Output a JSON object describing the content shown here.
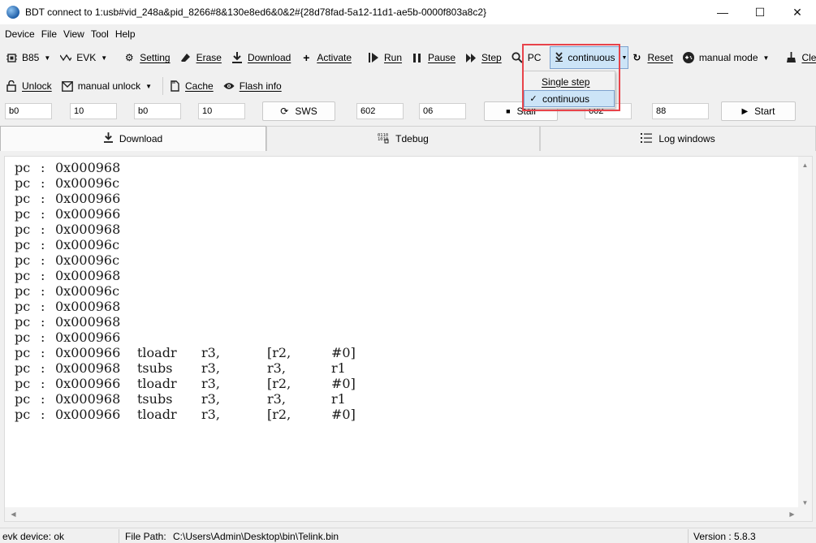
{
  "window": {
    "title": "BDT connect to 1:usb#vid_248a&pid_8266#8&130e8ed6&0&2#{28d78fad-5a12-11d1-ae5b-0000f803a8c2}",
    "minimize_glyph": "—",
    "maximize_glyph": "☐",
    "close_glyph": "✕"
  },
  "menu": [
    "Device",
    "File",
    "View",
    "Tool",
    "Help"
  ],
  "toolbar1": {
    "chip": "B85",
    "board": "EVK",
    "setting": "Setting",
    "erase": "Erase",
    "download": "Download",
    "activate": "Activate",
    "run": "Run",
    "pause": "Pause",
    "step": "Step",
    "pc": "PC",
    "mode": "continuous",
    "reset": "Reset",
    "manual_mode": "manual mode",
    "clear": "Clear"
  },
  "toolbar2": {
    "unlock": "Unlock",
    "manual_unlock": "manual unlock",
    "cache": "Cache",
    "flash_info": "Flash info"
  },
  "inputs": {
    "f1": "b0",
    "f2": "10",
    "f3": "b0",
    "f4": "10",
    "sws": "SWS",
    "f5": "602",
    "f6": "06",
    "stall": "Stall",
    "f7": "602",
    "f8": "88",
    "start": "Start"
  },
  "tabs": {
    "download": "Download",
    "tdebug": "Tdebug",
    "log": "Log windows"
  },
  "log": [
    {
      "pc": "pc",
      "colon": ":",
      "addr": "0x000968",
      "op": "",
      "a1": "",
      "a2": "",
      "a3": ""
    },
    {
      "pc": "pc",
      "colon": ":",
      "addr": "0x00096c",
      "op": "",
      "a1": "",
      "a2": "",
      "a3": ""
    },
    {
      "pc": "pc",
      "colon": ":",
      "addr": "0x000966",
      "op": "",
      "a1": "",
      "a2": "",
      "a3": ""
    },
    {
      "pc": "pc",
      "colon": ":",
      "addr": "0x000966",
      "op": "",
      "a1": "",
      "a2": "",
      "a3": ""
    },
    {
      "pc": "pc",
      "colon": ":",
      "addr": "0x000968",
      "op": "",
      "a1": "",
      "a2": "",
      "a3": ""
    },
    {
      "pc": "pc",
      "colon": ":",
      "addr": "0x00096c",
      "op": "",
      "a1": "",
      "a2": "",
      "a3": ""
    },
    {
      "pc": "pc",
      "colon": ":",
      "addr": "0x00096c",
      "op": "",
      "a1": "",
      "a2": "",
      "a3": ""
    },
    {
      "pc": "pc",
      "colon": ":",
      "addr": "0x000968",
      "op": "",
      "a1": "",
      "a2": "",
      "a3": ""
    },
    {
      "pc": "pc",
      "colon": ":",
      "addr": "0x00096c",
      "op": "",
      "a1": "",
      "a2": "",
      "a3": ""
    },
    {
      "pc": "pc",
      "colon": ":",
      "addr": "0x000968",
      "op": "",
      "a1": "",
      "a2": "",
      "a3": ""
    },
    {
      "pc": "pc",
      "colon": ":",
      "addr": "0x000968",
      "op": "",
      "a1": "",
      "a2": "",
      "a3": ""
    },
    {
      "pc": "pc",
      "colon": ":",
      "addr": "0x000966",
      "op": "",
      "a1": "",
      "a2": "",
      "a3": ""
    },
    {
      "pc": "pc",
      "colon": ":",
      "addr": "0x000966",
      "op": "tloadr",
      "a1": "r3,",
      "a2": "[r2,",
      "a3": "#0]"
    },
    {
      "pc": "pc",
      "colon": ":",
      "addr": "0x000968",
      "op": "tsubs",
      "a1": "r3,",
      "a2": "r3,",
      "a3": "r1"
    },
    {
      "pc": "pc",
      "colon": ":",
      "addr": "0x000966",
      "op": "tloadr",
      "a1": "r3,",
      "a2": "[r2,",
      "a3": "#0]"
    },
    {
      "pc": "pc",
      "colon": ":",
      "addr": "0x000968",
      "op": "tsubs",
      "a1": "r3,",
      "a2": "r3,",
      "a3": "r1"
    },
    {
      "pc": "pc",
      "colon": ":",
      "addr": "0x000966",
      "op": "tloadr",
      "a1": "r3,",
      "a2": "[r2,",
      "a3": "#0]"
    }
  ],
  "dropdown": {
    "single_step": "Single step",
    "continuous": "continuous",
    "checkmark": "✓"
  },
  "status": {
    "device": "evk device: ok",
    "file_path_label": "File Path:",
    "file_path": "C:\\Users\\Admin\\Desktop\\bin\\Telink.bin",
    "version": "Version : 5.8.3"
  },
  "colors": {
    "selection": "#cce4f7",
    "selection_border": "#7da2ce",
    "highlight": "#e8434a"
  }
}
